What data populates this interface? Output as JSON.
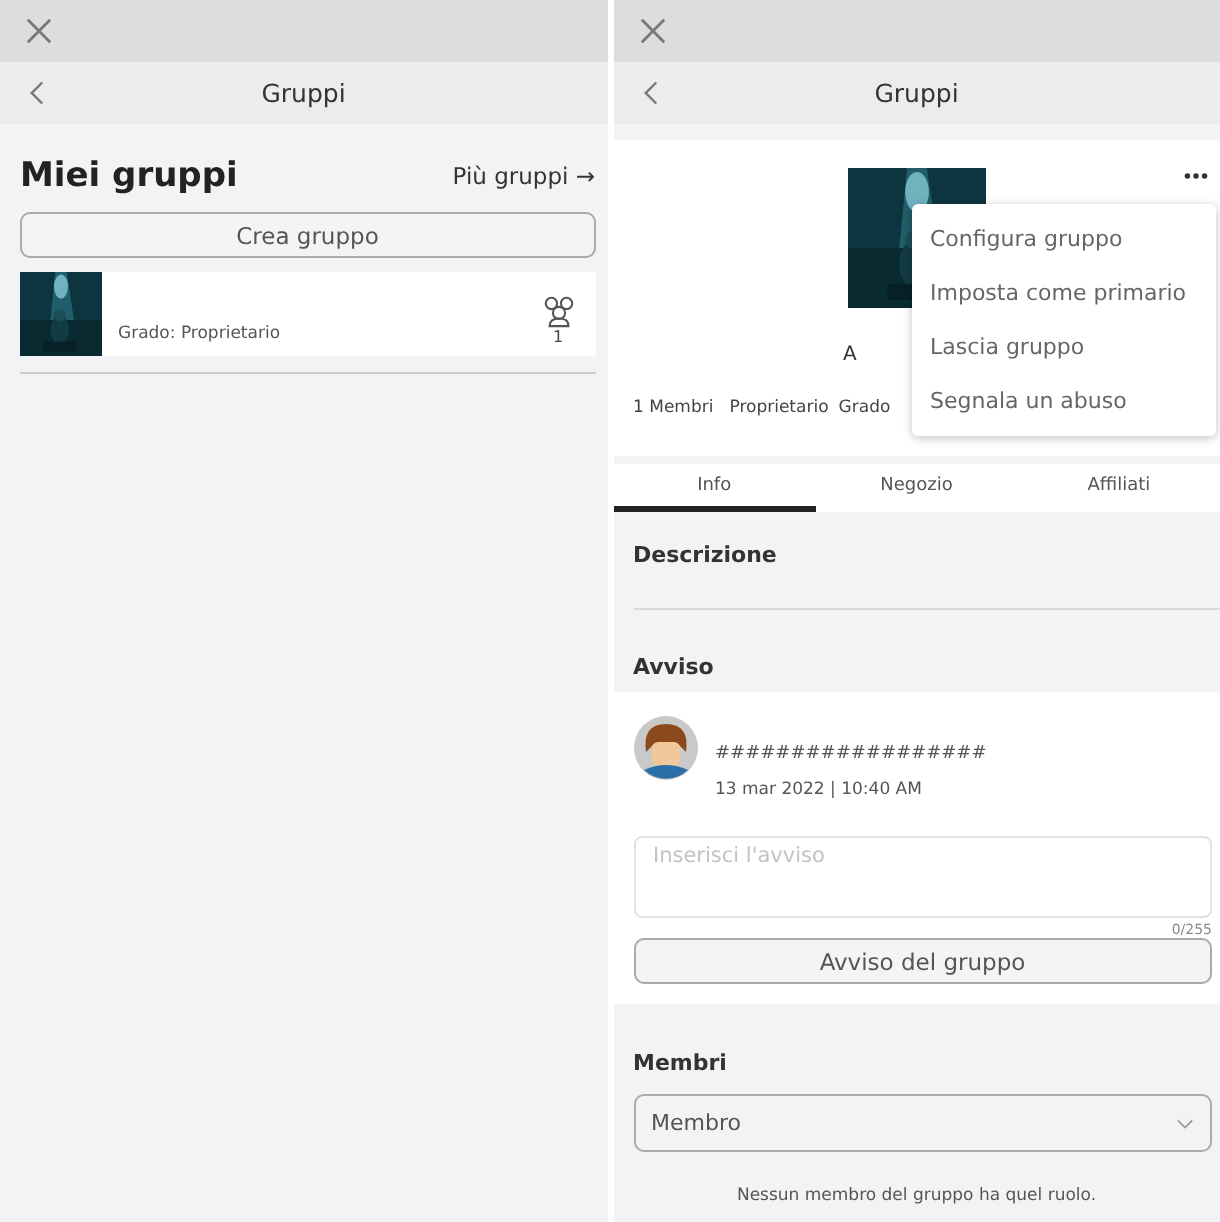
{
  "left": {
    "title": "Gruppi",
    "heading": "Miei gruppi",
    "more_link": "Più gruppi →",
    "create_button": "Crea gruppo",
    "groups": [
      {
        "rank": "Grado: Proprietario",
        "members": "1"
      }
    ]
  },
  "right": {
    "title": "Gruppi",
    "group_name": "A",
    "stats": [
      "1 Membri",
      "Proprietario",
      "Grado"
    ],
    "menu": [
      "Configura gruppo",
      "Imposta come primario",
      "Lascia gruppo",
      "Segnala un abuso"
    ],
    "tabs": [
      {
        "label": "Info",
        "selected": true
      },
      {
        "label": "Negozio",
        "selected": false
      },
      {
        "label": "Affiliati",
        "selected": false
      }
    ],
    "description_heading": "Descrizione",
    "notice_heading": "Avviso",
    "notice": {
      "text": "##################",
      "date": "13 mar 2022 | 10:40 AM"
    },
    "notice_field": {
      "placeholder": "Inserisci l'avviso",
      "counter": "0/255"
    },
    "notice_button": "Avviso del gruppo",
    "members_heading": "Membri",
    "role_select": "Membro",
    "empty_message": "Nessun membro del gruppo ha quel ruolo."
  }
}
